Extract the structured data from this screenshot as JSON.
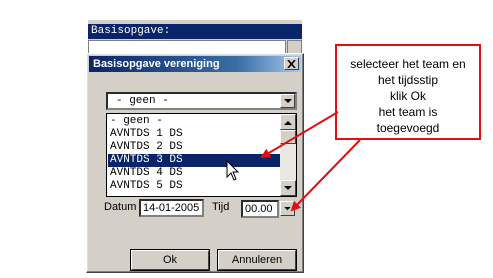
{
  "background_window": {
    "title": "Basisopgave:"
  },
  "dialog": {
    "title": "Basisopgave vereniging",
    "combo_value": "- geen -",
    "list_items": [
      "- geen -",
      "AVNTDS 1 DS",
      "AVNTDS 2 DS",
      "AVNTDS 3 DS",
      "AVNTDS 4 DS",
      "AVNTDS 5 DS"
    ],
    "selected_item": "AVNTDS 3 DS",
    "date_label": "Datum",
    "date_value": "14-01-2005",
    "time_label": "Tijd",
    "time_value": "00.00",
    "ok_label": "Ok",
    "cancel_label": "Annuleren"
  },
  "callout": {
    "lines": [
      "selecteer het team en",
      "het tijdsstip",
      "klik Ok",
      "het team is",
      "toegevoegd"
    ],
    "color": "#e01010"
  },
  "icons": {
    "close": "close-icon",
    "combo_arrow": "chevron-down-icon",
    "scroll_up": "scroll-up-icon",
    "scroll_down": "scroll-down-icon",
    "cursor": "mouse-pointer-icon"
  }
}
